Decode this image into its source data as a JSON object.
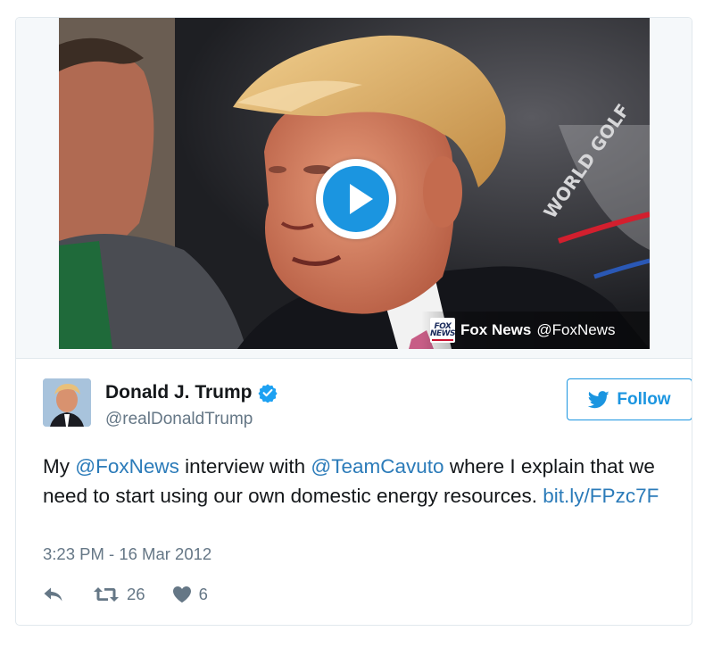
{
  "media": {
    "play_icon": "play-icon",
    "attribution": {
      "logo_icon": "fox-news-logo",
      "logo_text_line1": "FOX",
      "logo_text_line2": "NEWS",
      "name": "Fox News",
      "handle": "@FoxNews"
    }
  },
  "author": {
    "name": "Donald J. Trump",
    "handle": "@realDonaldTrump",
    "verified_icon": "verified-badge-icon",
    "avatar_icon": "avatar"
  },
  "follow": {
    "label": "Follow",
    "icon": "twitter-bird-icon"
  },
  "tweet": {
    "text_1": "My ",
    "mention_1": "@FoxNews",
    "text_2": " interview with ",
    "mention_2": "@TeamCavuto",
    "text_3": " where I explain that we need to start using our own domestic energy resources. ",
    "link": "bit.ly/FPzc7F",
    "timestamp": "3:23 PM - 16 Mar 2012"
  },
  "actions": {
    "reply_icon": "reply-icon",
    "retweet_icon": "retweet-icon",
    "retweet_count": "26",
    "like_icon": "heart-icon",
    "like_count": "6"
  },
  "colors": {
    "link": "#2b7bb9",
    "accent": "#1b95e0",
    "secondary_text": "#657786",
    "border": "#e1e8ed"
  }
}
